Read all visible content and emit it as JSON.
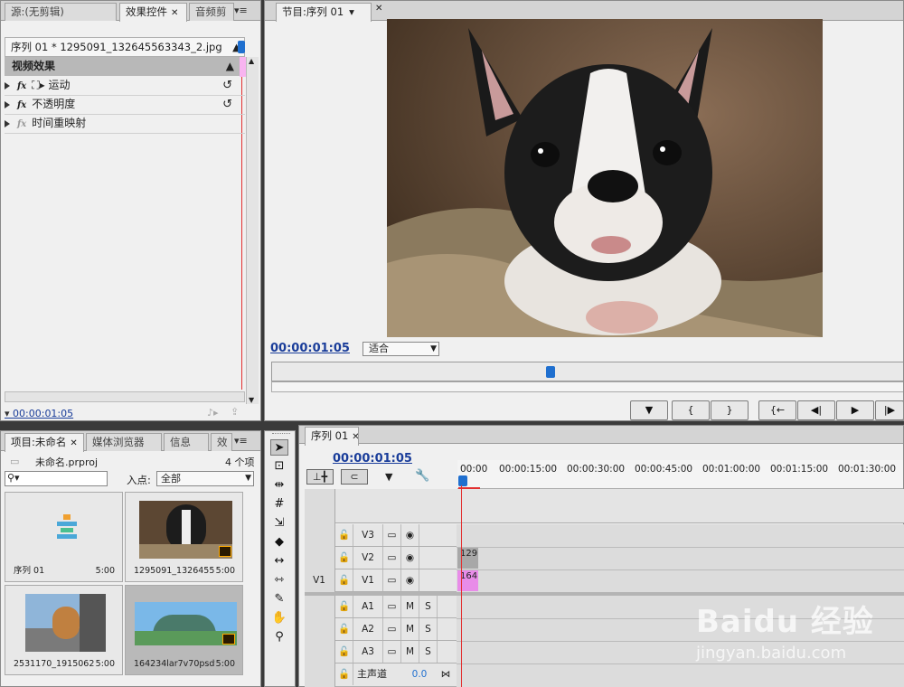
{
  "source_panel": {
    "tabs": [
      "源:(无剪辑)",
      "效果控件",
      "音频剪"
    ],
    "clip_label": "序列 01 * 1295091_132645563343_2.jpg",
    "section": "视频效果",
    "effects": [
      "运动",
      "不透明度",
      "时间重映射"
    ],
    "fx_label": "fx",
    "timecode": "00:00:01:05"
  },
  "program": {
    "tab": "节目:序列 01",
    "timecode": "00:00:01:05",
    "fit_value": "适合",
    "buttons": [
      "▼",
      "{",
      "}",
      "{←",
      "◀|",
      "▶",
      "|▶"
    ]
  },
  "project": {
    "tabs": [
      "项目:未命名",
      "媒体浏览器",
      "信息",
      "效"
    ],
    "file": "未命名.prproj",
    "count": "4 个项",
    "search_placeholder": "",
    "in_point_label": "入点:",
    "in_point_value": "全部",
    "items": [
      {
        "name": "序列 01",
        "duration": "5:00"
      },
      {
        "name": "1295091_1326455...",
        "duration": "5:00"
      },
      {
        "name": "2531170_1915062...",
        "duration": "5:00"
      },
      {
        "name": "164234lar7v70psdv...",
        "duration": "5:00"
      }
    ]
  },
  "timeline": {
    "tab": "序列 01",
    "timecode": "00:00:01:05",
    "ruler": [
      "00:00",
      "00:00:15:00",
      "00:00:30:00",
      "00:00:45:00",
      "00:01:00:00",
      "00:01:15:00",
      "00:01:30:00"
    ],
    "video_tracks": [
      {
        "name": "V3",
        "source": "",
        "clip": ""
      },
      {
        "name": "V2",
        "source": "",
        "clip": "129"
      },
      {
        "name": "V1",
        "source": "V1",
        "clip": "164"
      }
    ],
    "audio_tracks": [
      {
        "name": "A1",
        "m": "M",
        "s": "S"
      },
      {
        "name": "A2",
        "m": "M",
        "s": "S"
      },
      {
        "name": "A3",
        "m": "M",
        "s": "S"
      }
    ],
    "master_label": "主声道",
    "master_value": "0.0",
    "colors": {
      "v2_clip": "#a8a8a8",
      "v1_clip": "#e88ce8",
      "playhead": "#e23030",
      "timecode": "#1a3d9a"
    }
  },
  "watermark": {
    "brand": "Baidu 经验",
    "url": "jingyan.baidu.com"
  }
}
